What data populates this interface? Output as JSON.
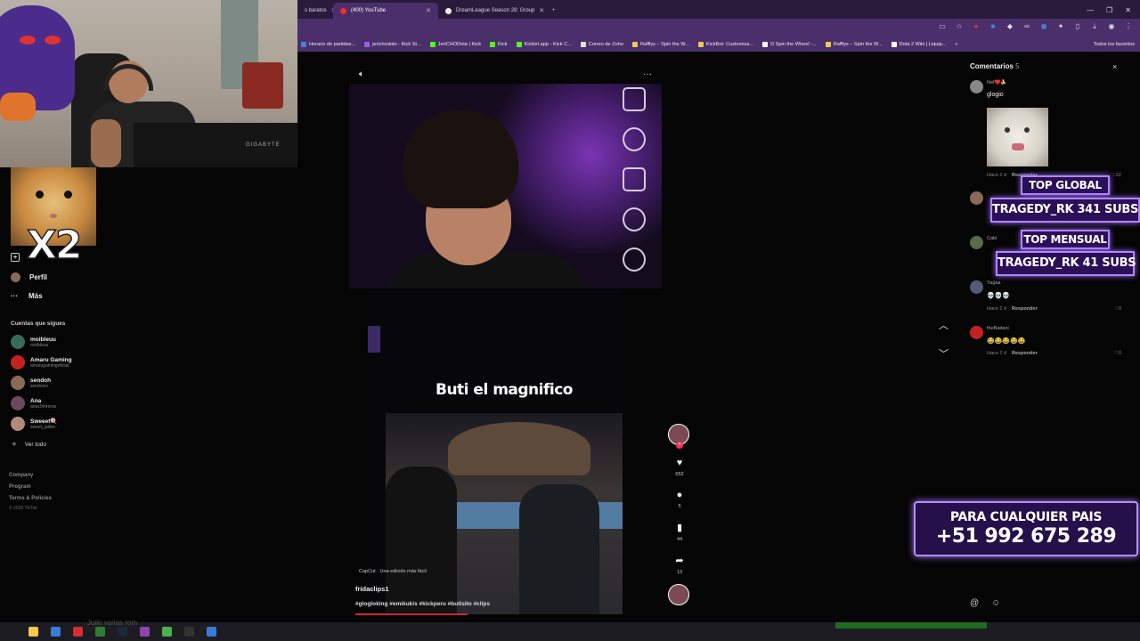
{
  "browser": {
    "tabs": [
      {
        "label": "s baratos",
        "color": "#7a5a9a",
        "active": false
      },
      {
        "label": "(400) YouTube",
        "color": "#ff2b2b",
        "active": true
      },
      {
        "label": "DreamLeague Season 28: Group",
        "color": "#eeeeee",
        "active": false
      }
    ],
    "new_tab_icon": "+",
    "bookmarks": [
      {
        "label": "Horario de partidas...",
        "color": "#4a7fd6"
      },
      {
        "label": "jerichodoto - Kick St...",
        "color": "#9b5de5"
      },
      {
        "label": "JeriCHODota | Kick",
        "color": "#53fc18"
      },
      {
        "label": "Kick",
        "color": "#53fc18"
      },
      {
        "label": "Kicklet.app - Kick C...",
        "color": "#53fc18"
      },
      {
        "label": "Correo de Zoho",
        "color": "#e0e0e0"
      },
      {
        "label": "Rafflys – Spin the W...",
        "color": "#f2c94c"
      },
      {
        "label": "KickBot: Customiza...",
        "color": "#f2c94c"
      },
      {
        "label": "D Spin the Wheel -...",
        "color": "#ffffff"
      },
      {
        "label": "Rafflys – Spin the W...",
        "color": "#f2c94c"
      },
      {
        "label": "Dota 2 Wiki | Liquip...",
        "color": "#ffffff"
      }
    ],
    "bookmarks_all": "Todos los favoritos"
  },
  "webcam": {
    "monitor_brand": "GIGABYTE"
  },
  "hamster_overlay": {
    "text": "X2"
  },
  "sidebar": {
    "nav": [
      {
        "label": "",
        "icon": "add-icon"
      },
      {
        "label": "Perfil",
        "icon": "avatar"
      },
      {
        "label": "Más",
        "icon": "more-icon"
      }
    ],
    "following_title": "Cuentas que sigues",
    "following": [
      {
        "name": "moibleuu",
        "handle": "moibleuu",
        "color": "#3a6b5a"
      },
      {
        "name": "Amaru Gaming",
        "handle": "amarugamingoficial",
        "color": "#c42222"
      },
      {
        "name": "sendoh",
        "handle": "sendorro",
        "color": "#8a6a55"
      },
      {
        "name": "Ana",
        "handle": "anac0ntreras",
        "color": "#6a4a5a"
      },
      {
        "name": "Sweeet🍭",
        "handle": "sweet_jadee",
        "color": "#b08a7a"
      }
    ],
    "see_all": "Ver todo",
    "footer": [
      "Company",
      "Program",
      "Terms & Policies"
    ],
    "copyright": "© 2026 TikTok"
  },
  "video": {
    "caption": "Buti el magnifico",
    "capcut": "CapCut · Una edición más fácil",
    "author": "fridaclips1",
    "hashtags": "#glogloking #emikukis #kickperu #butisito #clips",
    "progress_fraction": 0.18,
    "likes": "652",
    "comments": "5",
    "saves": "44",
    "shares": "13"
  },
  "comments": {
    "title": "Comentarios",
    "count": "5",
    "close": "×",
    "items": [
      {
        "user": "Nef♥️🍌",
        "text": "glogio",
        "time": "Hace 2 d",
        "reply": "Responder",
        "likes": "22",
        "color": "#888"
      },
      {
        "user": "",
        "text": "",
        "time": "",
        "reply": "",
        "likes": "",
        "color": "#8a6a55"
      },
      {
        "user": "Cabi",
        "text": "",
        "time": "",
        "reply": "",
        "likes": "",
        "color": "#5a6a4a"
      },
      {
        "user": "Yagaa",
        "text": "💀💀💀",
        "time": "Hace 2 d",
        "reply": "Responder",
        "likes": "0",
        "color": "#555a7a"
      },
      {
        "user": "theBadani",
        "text": "😂😂😂😂😂",
        "time": "Hace 2 d",
        "reply": "Responder",
        "likes": "0",
        "color": "#c42222"
      }
    ]
  },
  "stream_overlay": {
    "top_global_label": "TOP GLOBAL",
    "top_global_value": "TRAGEDY_RK 341 SUBS",
    "top_monthly_label": "TOP MENSUAL",
    "top_monthly_value": "TRAGEDY_RK 41 SUBS",
    "promo_line1": "PARA CUALQUIER PAIS",
    "promo_line2": "+51 992 675 289",
    "partial_text": "Juiio varias rom"
  },
  "taskbar": {
    "icons": [
      {
        "name": "file-explorer-icon",
        "color": "#f2c94c"
      },
      {
        "name": "bluetooth-icon",
        "color": "#3a7bd5"
      },
      {
        "name": "opera-icon",
        "color": "#d32f2f"
      },
      {
        "name": "app-icon",
        "color": "#2e7d32"
      },
      {
        "name": "steam-icon",
        "color": "#1b2838"
      },
      {
        "name": "messenger-icon",
        "color": "#8e44ad"
      },
      {
        "name": "chrome-icon",
        "color": "#4caf50"
      },
      {
        "name": "obs-icon",
        "color": "#333333"
      },
      {
        "name": "notepad-icon",
        "color": "#3a7bd5"
      }
    ]
  }
}
